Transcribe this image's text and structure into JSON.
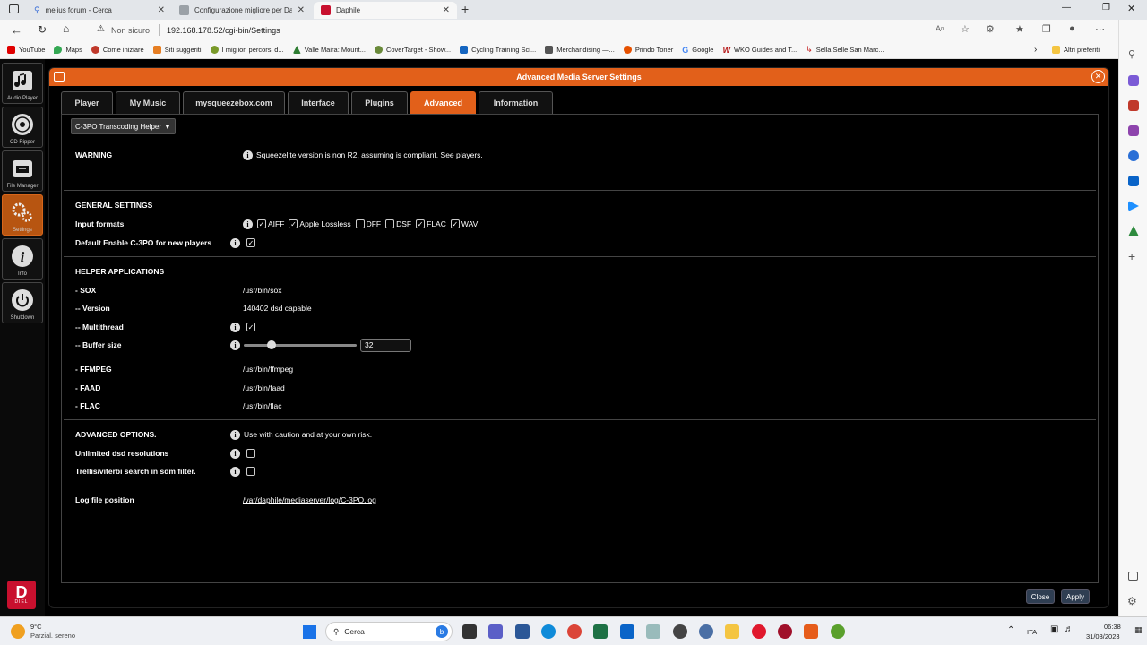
{
  "browser": {
    "tabs": [
      {
        "label": "melius forum - Cerca",
        "color": "#3b6fd8"
      },
      {
        "label": "Configurazione migliore per Dap",
        "color": "#9aa0a6"
      },
      {
        "label": "Daphile",
        "color": "#c8102e"
      }
    ],
    "security_label": "Non sicuro",
    "url": "192.168.178.52/cgi-bin/Settings",
    "bookmarks": [
      {
        "label": "YouTube",
        "color": "#e00000"
      },
      {
        "label": "Maps",
        "color": "#34a853"
      },
      {
        "label": "Come iniziare",
        "color": "#c0392b"
      },
      {
        "label": "Siti suggeriti",
        "color": "#e67e22"
      },
      {
        "label": "I migliori percorsi d...",
        "color": "#7a9a2a"
      },
      {
        "label": "Valle Maira: Mount...",
        "color": "#2e7d32"
      },
      {
        "label": "CoverTarget - Show...",
        "color": "#6a8a3a"
      },
      {
        "label": "Cycling Training Sci...",
        "color": "#1565c0"
      },
      {
        "label": "Merchandising —...",
        "color": "#555555"
      },
      {
        "label": "Prindo Toner",
        "color": "#e65100"
      },
      {
        "label": "Google",
        "color": "#4285f4"
      },
      {
        "label": "WKO Guides and T...",
        "color": "#b71c1c"
      },
      {
        "label": "Sella Selle San Marc...",
        "color": "#c62828"
      }
    ],
    "other_bookmarks": "Altri preferiti"
  },
  "leftnav": [
    {
      "label": "Audio Player"
    },
    {
      "label": "CD Ripper"
    },
    {
      "label": "File Manager"
    },
    {
      "label": "Settings"
    },
    {
      "label": "Info"
    },
    {
      "label": "Shutdown"
    }
  ],
  "brand_text": "DIEL",
  "dialog": {
    "title": "Advanced Media Server Settings",
    "tabs": [
      "Player",
      "My Music",
      "mysqueezebox.com",
      "Interface",
      "Plugins",
      "Advanced",
      "Information"
    ],
    "plugin_select": "C-3PO Transcoding Helper",
    "warning_label": "WARNING",
    "warning_text": "Squeezelite version is non R2, assuming is compliant. See players.",
    "general_header": "GENERAL SETTINGS",
    "input_formats_label": "Input formats",
    "formats": [
      {
        "name": "AIFF",
        "checked": true
      },
      {
        "name": "Apple Lossless",
        "checked": true
      },
      {
        "name": "DFF",
        "checked": false
      },
      {
        "name": "DSF",
        "checked": false
      },
      {
        "name": "FLAC",
        "checked": true
      },
      {
        "name": "WAV",
        "checked": true
      }
    ],
    "default_enable_label": "Default Enable C-3PO for new players",
    "helper_header": "HELPER APPLICATIONS",
    "sox_label": "- SOX",
    "sox_path": "/usr/bin/sox",
    "version_label": "-- Version",
    "version_value": "140402 dsd capable",
    "multithread_label": "-- Multithread",
    "buffer_label": "-- Buffer size",
    "buffer_value": "32",
    "buffer_level": 0.22,
    "ffmpeg_label": "- FFMPEG",
    "ffmpeg_path": "/usr/bin/ffmpeg",
    "faad_label": "- FAAD",
    "faad_path": "/usr/bin/faad",
    "flac_label": "- FLAC",
    "flac_path": "/usr/bin/flac",
    "advanced_header": "ADVANCED OPTIONS.",
    "advanced_note": "Use with caution and at your own risk.",
    "unlimited_label": "Unlimited dsd resolutions",
    "trellis_label": "Trellis/viterbi search in sdm filter.",
    "log_label": "Log file position",
    "log_path": "/var/daphile/mediaserver/log/C-3PO.log",
    "close_label": "Close",
    "apply_label": "Apply"
  },
  "taskbar": {
    "weather_temp": "9°C",
    "weather_desc": "Parzial. sereno",
    "search_label": "Cerca",
    "lang": "ITA",
    "time": "06:38",
    "date": "31/03/2023"
  }
}
